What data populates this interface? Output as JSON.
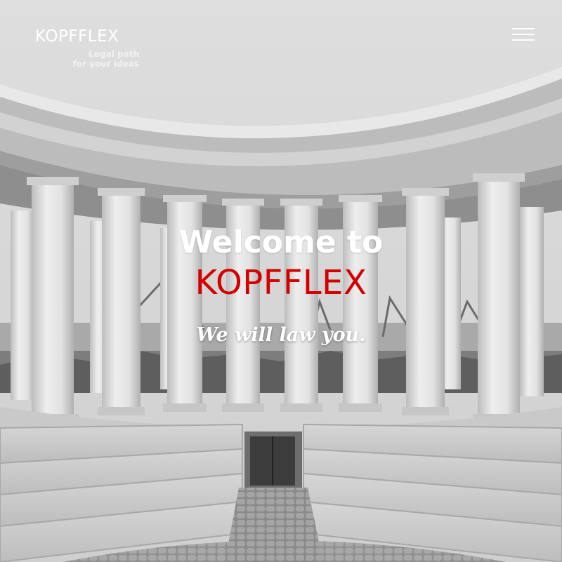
{
  "brand": {
    "name": "KOPFFLEX",
    "tagline_line1": "Legal path",
    "tagline_line2": "for your ideas"
  },
  "menu": {
    "icon": "hamburger-menu-icon"
  },
  "hero": {
    "heading_line1": "Welcome to",
    "heading_line2": "KOPFFLEX",
    "subheading": "We will law you.",
    "background": "black-and-white photo of a semicircular colonnade with stone steps and a harbour behind",
    "accent_color": "#d40000",
    "text_color": "#ffffff"
  }
}
